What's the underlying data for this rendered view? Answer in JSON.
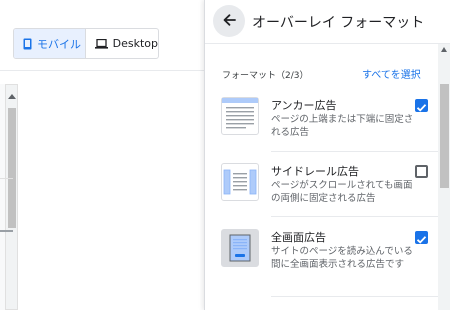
{
  "device_toggle": {
    "mobile_label": "モバイル",
    "desktop_label": "Desktop"
  },
  "panel": {
    "title": "オーバーレイ フォーマット",
    "section_label": "フォーマット（2/3）",
    "select_all": "すべてを選択",
    "items": [
      {
        "title": "アンカー広告",
        "description": "ページの上端または下端に固定される広告",
        "checked": true,
        "icon": "anchor-ad-icon"
      },
      {
        "title": "サイドレール広告",
        "description": "ページがスクロールされても画面の両側に固定される広告",
        "checked": false,
        "icon": "side-rail-ad-icon"
      },
      {
        "title": "全画面広告",
        "description": "サイトのページを読み込んでいる間に全画面表示される広告です",
        "checked": true,
        "icon": "fullscreen-ad-icon"
      }
    ]
  },
  "colors": {
    "accent": "#1a73e8",
    "selected_bg": "#e8f0fe"
  }
}
